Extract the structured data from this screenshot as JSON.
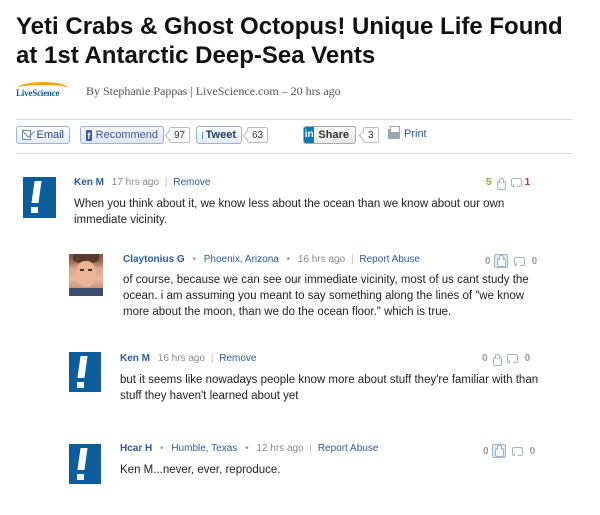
{
  "article": {
    "title": "Yeti Crabs & Ghost Octopus! Unique Life Found at 1st Antarctic Deep-Sea Vents",
    "logo_text": "LiveScience",
    "byline": "By Stephanie Pappas | LiveScience.com – 20 hrs ago"
  },
  "share": {
    "email_label": "Email",
    "facebook_label": "Recommend",
    "facebook_count": "97",
    "tweet_label": "Tweet",
    "tweet_count": "63",
    "linkedin_icon": "in",
    "linkedin_label": "Share",
    "linkedin_count": "3",
    "print_label": "Print"
  },
  "comments": [
    {
      "author": "Ken M",
      "time": "17 hrs ago",
      "action": "Remove",
      "text": "When you think about it, we know less about the ocean than we know about our own immediate vicinity.",
      "thumbs_up": "5",
      "thumbs_down": "1",
      "avatar": "exclamation-avatar"
    },
    {
      "author": "Claytonius G",
      "location": "Phoenix, Arizona",
      "time": "16 hrs ago",
      "action": "Report Abuse",
      "text": "of course, because we can see our immediate vicinity, most of us cant study the ocean. i am assuming you meant to say something along the lines of \"we know more about the moon, than we do the ocean floor.\" which is true.",
      "thumbs_up": "0",
      "thumbs_down": "0",
      "avatar": "photo-avatar"
    },
    {
      "author": "Ken M",
      "time": "16 hrs ago",
      "action": "Remove",
      "text": "but it seems like nowadays people know more about stuff they're familiar with than stuff they haven't learned about yet",
      "thumbs_up": "0",
      "thumbs_down": "0",
      "avatar": "exclamation-avatar"
    },
    {
      "author": "Hcar H",
      "location": "Humble, Texas",
      "time": "12 hrs ago",
      "action": "Report Abuse",
      "text": "Ken M...never, ever, reproduce.",
      "thumbs_up": "0",
      "thumbs_down": "0",
      "avatar": "exclamation-avatar"
    }
  ],
  "colors": {
    "link": "#2a5aa8",
    "avatar_blue": "#0b5d9c",
    "vote_up": "#7ab520",
    "vote_down": "#d03020"
  }
}
